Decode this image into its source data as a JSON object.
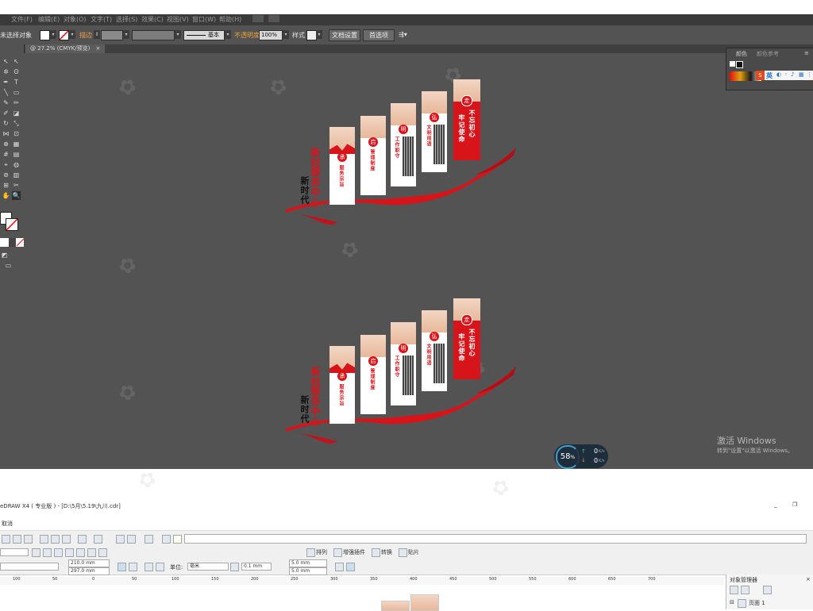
{
  "illustrator": {
    "menus": [
      "文件(F)",
      "编辑(E)",
      "对象(O)",
      "文字(T)",
      "选择(S)",
      "效果(C)",
      "视图(V)",
      "窗口(W)",
      "帮助(H)"
    ],
    "control": {
      "selection_label": "未选择对象",
      "stroke_label": "描边",
      "stroke_style": "基本",
      "opacity_label": "不透明度",
      "opacity_value": "100%",
      "style_label": "样式",
      "doc_setup_button": "文档设置",
      "prefs_button": "首选项"
    },
    "doc_tab": "@ 27.2% (CMYK/预览)",
    "panel": {
      "tab_color": "颜色",
      "tab_color_guide": "颜色参考"
    },
    "ime": {
      "lang": "英"
    }
  },
  "artwork": {
    "side_small": "新时代",
    "side_big": "服务中心",
    "side_red": "新时",
    "panels": [
      {
        "badge": "承",
        "label": "服务宗旨"
      },
      {
        "badge": "启",
        "label": "管理制度"
      },
      {
        "badge": "明",
        "label": "工作职守"
      },
      {
        "badge": "弘",
        "label": "文明用语"
      }
    ],
    "hero": {
      "badge": "走",
      "line1": "不忘初心",
      "line2": "牢记使命"
    }
  },
  "system": {
    "activate_title": "激活 Windows",
    "activate_sub": "转到\"设置\"以激活 Windows。",
    "net_percent": "58",
    "net_percent_unit": "%",
    "up_speed": "0",
    "down_speed": "0",
    "speed_unit": "K/s"
  },
  "coreldraw": {
    "title": "eDRAW X4 ( 专业版 ) - [D:\\5月\\5.19\\九川.cdr]",
    "menu_cancel": "取消",
    "toolbar_items": [
      "排列",
      "增强插件",
      "转换",
      "贴片"
    ],
    "width_value": "210.0 mm",
    "height_value": "297.0 mm",
    "unit_label": "单位:",
    "unit_value": "毫米",
    "nudge_value": "0.1 mm",
    "dup_x": "5.0 mm",
    "dup_y": "5.0 mm",
    "ruler_ticks": [
      "100",
      "50",
      "0",
      "50",
      "100",
      "150",
      "200",
      "250",
      "300",
      "350",
      "400",
      "450",
      "500",
      "550",
      "600",
      "650",
      "700"
    ],
    "object_manager_title": "对象管理器",
    "layer_label": "页面 1"
  },
  "colors": {
    "accent_red": "#d7141a",
    "ai_canvas": "#535353",
    "orange_label": "#f0a040"
  }
}
